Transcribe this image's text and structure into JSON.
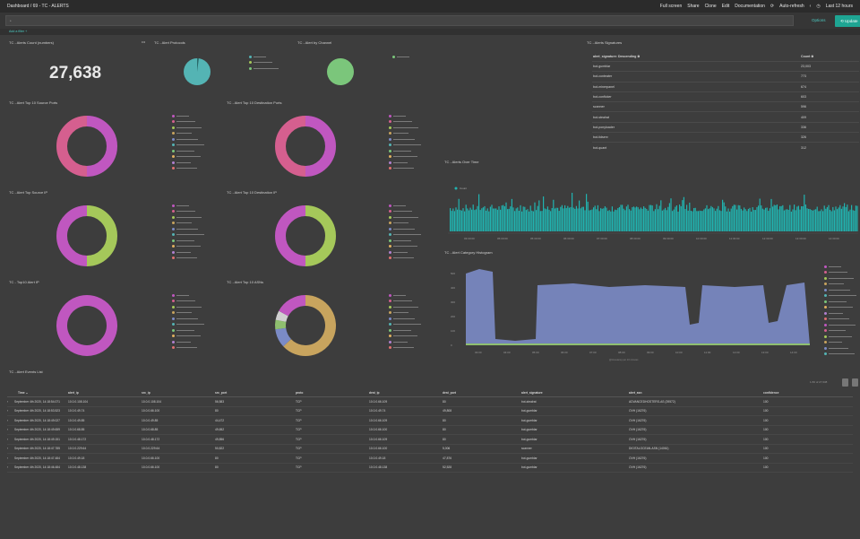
{
  "header": {
    "breadcrumb": "Dashboard / 69 - TC - ALERTS",
    "nav": [
      "Full screen",
      "Share",
      "Clone",
      "Edit",
      "Documentation",
      "Auto-refresh"
    ],
    "time_range": "Last 12 hours"
  },
  "query": {
    "value": "*",
    "options_label": "Options",
    "update_label": "Update",
    "add_filter": "Add a filter +"
  },
  "panels": {
    "count_title": "TC - Alerts Count (numbers)",
    "count_value": "27,638",
    "protocols_title": "TC - Alert Protocols",
    "channel_title": "TC - Alert by Channel",
    "signatures_title": "TC - Alerts Signatures",
    "src_ports_title": "TC - Alert Top 10 Source Ports",
    "dst_ports_title": "TC - Alert Top 10 Destination Ports",
    "src_ip_title": "TC - Alert Top Source IP",
    "dst_ip_title": "TC - Alert Top 10 Destination IP",
    "alert_ip_title": "TC - Top10 Alert IP",
    "asns_title": "TC - Alert Top 10 ASNs",
    "over_time_title": "TC - Alerts Over Time",
    "histogram_title": "TC - Alert Category Histogram",
    "events_title": "TC - Alert Events List"
  },
  "colors": {
    "teal": "#54b4b4",
    "green": "#7bc67b",
    "magenta": "#c057c0",
    "rose": "#d55f8f",
    "lime": "#a5c85a",
    "tan": "#c8a45e",
    "slate": "#7b8bc6",
    "cyan": "#21b3b0",
    "track": "#3a8a94"
  },
  "signatures": {
    "headers": [
      "alert_signature: Descending ≑",
      "Count ≑"
    ],
    "rows": [
      [
        "bot-gumblar",
        "23,003"
      ],
      [
        "bot-conteater",
        "773"
      ],
      [
        "bot-minerpanel",
        "674"
      ],
      [
        "bot-conficker",
        "603"
      ],
      [
        "scanner",
        "596"
      ],
      [
        "bot-stealrat",
        "409"
      ],
      [
        "bot-ponyloader",
        "336"
      ],
      [
        "bot-tidserv",
        "326"
      ],
      [
        "bot-quant",
        "312"
      ]
    ]
  },
  "over_time": {
    "ticks": [
      "03:00:00",
      "05:00:00",
      "05:30:00",
      "06:30:00",
      "07:30:00",
      "08:30:00",
      "09:30:00",
      "10:30:00",
      "11:30:00",
      "12:30:00",
      "13:30:00",
      "14:30:00"
    ],
    "legend": "Count"
  },
  "histogram": {
    "yticks": [
      "500",
      "400",
      "300",
      "200",
      "100",
      "0"
    ],
    "xticks": [
      "03:00",
      "04:00",
      "05:00",
      "06:00",
      "07:00",
      "08:00",
      "09:00",
      "10:00",
      "11:00",
      "12:00",
      "13:00",
      "14:00"
    ],
    "xlabel": "@timestamp per 10 minutes"
  },
  "events": {
    "pagination": "1-50 of 27,638",
    "headers": [
      "Time ⌄",
      "alert_ip",
      "src_ip",
      "src_port",
      "proto",
      "dest_ip",
      "dest_port",
      "alert_signature",
      "alert_asn",
      "confidence"
    ],
    "rows": [
      [
        "September 4th 2020, 14:18:54.071",
        "10.0.0.108.104",
        "10.0.0.108.104",
        "56,583",
        "TCP",
        "10.0.0.66.109",
        "80",
        "bot-stealrat",
        "ADVANCEDHOSTERS-AS (39572)",
        "100"
      ],
      [
        "September 4th 2020, 14:18:53.523",
        "10.0.0.49.74",
        "10.0.0.66.100",
        "80",
        "TCP",
        "10.0.0.49.74",
        "49,808",
        "bot-gumblar",
        "OVH (16276)",
        "100"
      ],
      [
        "September 4th 2020, 14:18:49.027",
        "10.0.0.49.85",
        "10.0.0.49.85",
        "44,472",
        "TCP",
        "10.0.0.66.109",
        "80",
        "bot-gumblar",
        "OVH (16276)",
        "100"
      ],
      [
        "September 4th 2020, 14:18:49.659",
        "10.0.0.68.85",
        "10.0.0.68.85",
        "49,652",
        "TCP",
        "10.0.0.66.100",
        "80",
        "bot-gumblar",
        "OVH (16276)",
        "100"
      ],
      [
        "September 4th 2020, 14:18:49.151",
        "10.0.0.48.172",
        "10.0.0.48.172",
        "49,856",
        "TCP",
        "10.0.0.66.109",
        "80",
        "bot-gumblar",
        "OVH (16276)",
        "100"
      ],
      [
        "September 4th 2020, 14:18:47.785",
        "10.0.0.229.64",
        "10.0.0.229.64",
        "50,822",
        "TCP",
        "10.0.0.66.100",
        "5,006",
        "scanner",
        "DIGITALOCEAN-ASN (14061)",
        "100"
      ],
      [
        "September 4th 2020, 14:18:47.484",
        "10.0.0.49.18",
        "10.0.0.66.100",
        "80",
        "TCP",
        "10.0.0.49.18",
        "47,876",
        "bot-gumblar",
        "OVH (16276)",
        "100"
      ],
      [
        "September 4th 2020, 14:18:46.484",
        "10.0.0.48.138",
        "10.0.0.66.100",
        "80",
        "TCP",
        "10.0.0.48.138",
        "52,528",
        "bot-gumblar",
        "OVH (16276)",
        "100"
      ]
    ]
  }
}
